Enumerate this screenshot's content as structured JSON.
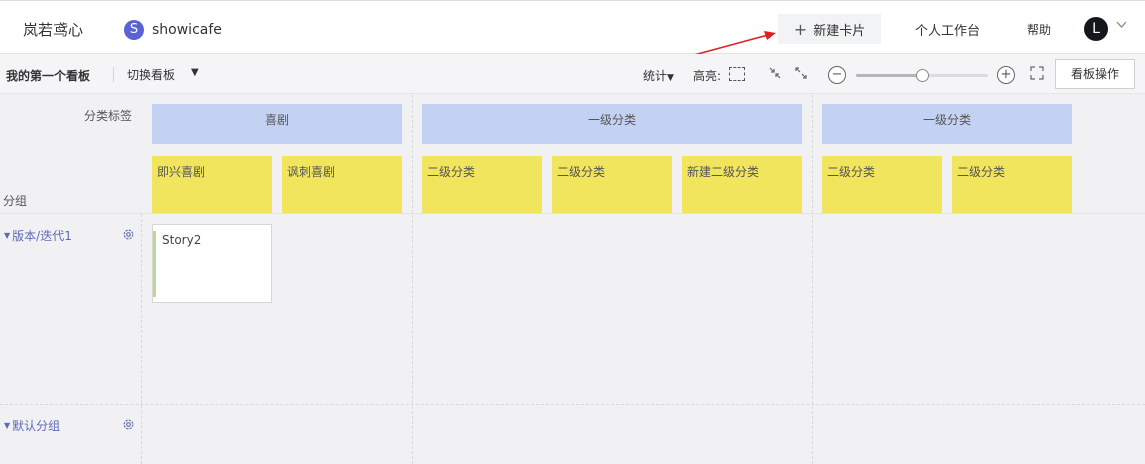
{
  "header": {
    "brand": "岚若鸢心",
    "project_icon_letter": "S",
    "project_name": "showicafe",
    "new_card_label": "新建卡片",
    "workspace_label": "个人工作台",
    "help_label": "帮助",
    "avatar_letter": "L"
  },
  "toolbar": {
    "board_title": "我的第一个看板",
    "switch_label": "切换看板",
    "stats_label": "统计",
    "highlight_label": "高亮:",
    "zoom_level": 0.5,
    "board_actions_label": "看板操作"
  },
  "board": {
    "header_label": "分类标签",
    "group_label": "分组",
    "level1": [
      "喜剧",
      "一级分类",
      "一级分类"
    ],
    "level2": [
      "即兴喜剧",
      "讽刺喜剧",
      "二级分类",
      "二级分类",
      "新建二级分类",
      "二级分类",
      "二级分类"
    ],
    "rows": [
      {
        "label": "版本/迭代1",
        "cards": [
          "Story2"
        ]
      },
      {
        "label": "默认分组",
        "cards": []
      }
    ]
  },
  "colors": {
    "level1_bg": "#c3d2f2",
    "level2_bg": "#f1e55e",
    "accent": "#5b62d6",
    "row_label": "#5d6ab8",
    "card_bar": "#b6dc8e",
    "annotation_arrow": "#e02020"
  },
  "icons": [
    "plus-icon",
    "chevron-down-icon",
    "caret-down-icon",
    "highlight-box-icon",
    "collapse-icon",
    "expand-icon",
    "zoom-out-icon",
    "zoom-in-icon",
    "fullscreen-icon",
    "gear-icon",
    "annotation-arrow-icon"
  ]
}
